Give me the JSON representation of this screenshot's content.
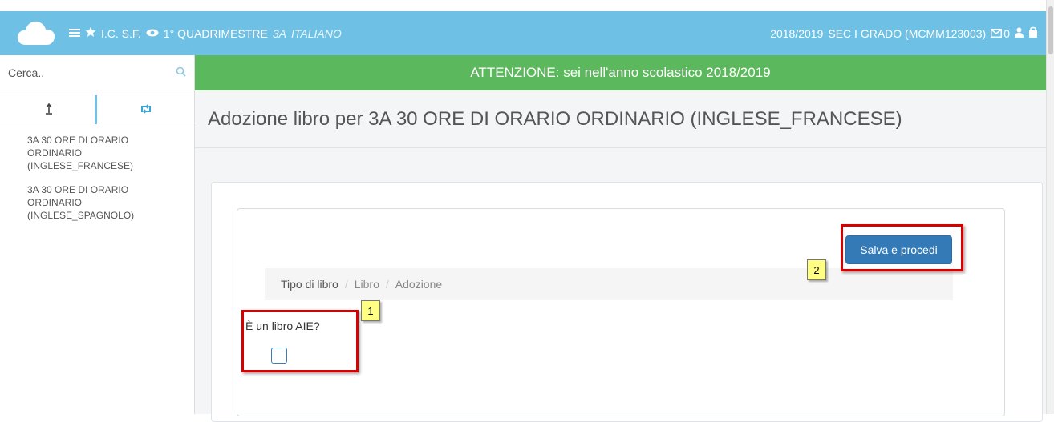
{
  "topbar": {
    "school": "I.C. S.F.",
    "period": "1° QUADRIMESTRE",
    "class": "3A",
    "subject": "ITALIANO",
    "year": "2018/2019",
    "school_code": "SEC I GRADO (MCMM123003)",
    "messages_count": "0",
    "bg_color": "#6ec1e4"
  },
  "sidebar": {
    "search_placeholder": "Cerca..",
    "items": [
      {
        "label": "3A 30 ORE DI ORARIO ORDINARIO (INGLESE_FRANCESE)"
      },
      {
        "label": "3A 30 ORE DI ORARIO ORDINARIO (INGLESE_SPAGNOLO)"
      }
    ]
  },
  "alert": {
    "text": "ATTENZIONE: sei nell'anno scolastico 2018/2019",
    "color": "#5cb85c"
  },
  "page": {
    "title": "Adozione libro per 3A 30 ORE DI ORARIO ORDINARIO (INGLESE_FRANCESE)"
  },
  "form": {
    "save_label": "Salva e procedi",
    "breadcrumb": [
      "Tipo di libro",
      "Libro",
      "Adozione"
    ],
    "question": "È un libro AIE?",
    "checked": false
  },
  "annotations": {
    "marker_1": "1",
    "marker_2": "2"
  }
}
